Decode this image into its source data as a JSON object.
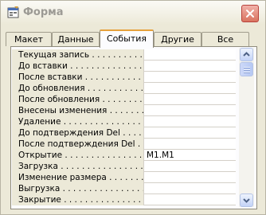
{
  "window": {
    "title": "Форма",
    "colors": {
      "titlebar_text": "#9c9a94",
      "close_button": "#d9735f",
      "panel_bg": "#ece9d8",
      "active_tab_accent": "#e6a23c"
    }
  },
  "tabs": [
    {
      "label": "Макет",
      "active": false
    },
    {
      "label": "Данные",
      "active": false
    },
    {
      "label": "События",
      "active": true
    },
    {
      "label": "Другие",
      "active": false
    },
    {
      "label": "Все",
      "active": false
    }
  ],
  "properties": [
    {
      "label": "Текущая запись . . . . . . . . . . .",
      "value": ""
    },
    {
      "label": "До вставки . . . . . . . . . . . . . . .",
      "value": ""
    },
    {
      "label": "После вставки . . . . . . . . . . . . .",
      "value": ""
    },
    {
      "label": "До обновления . . . . . . . . . . . .",
      "value": ""
    },
    {
      "label": "После обновления . . . . . . . . . .",
      "value": ""
    },
    {
      "label": "Внесены изменения . . . . . . . . .",
      "value": ""
    },
    {
      "label": "Удаление . . . . . . . . . . . . . . . .",
      "value": ""
    },
    {
      "label": "До подтверждения Del . . . . . . .",
      "value": ""
    },
    {
      "label": "После подтверждения Del . . . . .",
      "value": ""
    },
    {
      "label": "Открытие . . . . . . . . . . . . . . . .",
      "value": "M1.M1"
    },
    {
      "label": "Загрузка . . . . . . . . . . . . . . . .",
      "value": ""
    },
    {
      "label": "Изменение размера . . . . . . . .",
      "value": ""
    },
    {
      "label": "Выгрузка . . . . . . . . . . . . . . . .",
      "value": ""
    },
    {
      "label": "Закрытие . . . . . . . . . . . . . . . .",
      "value": ""
    }
  ],
  "scrollbar": {
    "position": 0.0
  }
}
